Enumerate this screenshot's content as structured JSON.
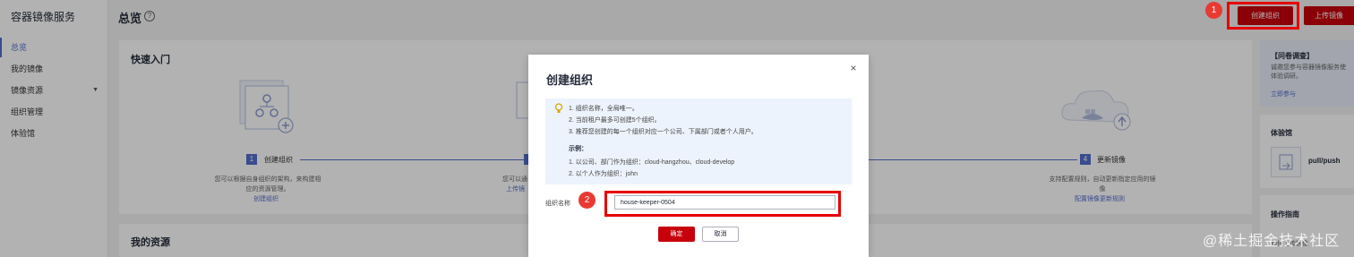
{
  "sidebar": {
    "title": "容器镜像服务",
    "items": [
      {
        "label": "总览"
      },
      {
        "label": "我的镜像"
      },
      {
        "label": "镜像资源"
      },
      {
        "label": "组织管理"
      },
      {
        "label": "体验馆"
      }
    ]
  },
  "header": {
    "title": "总览",
    "help_icon": "?",
    "create_org_label": "创建组织",
    "upload_label": "上传镜像",
    "badge1": "1"
  },
  "quick_start": {
    "title": "快速入门",
    "step1": {
      "num": "1",
      "label": "创建组织",
      "desc": "您可以根据自身组织的架构，来构建相应的资源管理。",
      "link": "创建组织"
    },
    "step2": {
      "desc_partial": "您可以通",
      "link_partial": "上传镜"
    },
    "step4": {
      "num": "4",
      "label": "更新镜像",
      "desc": "支持配置规则，自动更新指定应用的镜像",
      "link": "配置镜像更新规则"
    }
  },
  "resources": {
    "title": "我的资源"
  },
  "right_panel": {
    "survey": {
      "title": "【问卷调查】",
      "text1": "诚邀您参与容器镜像服务使",
      "text2": "体验调研。",
      "link": "立即参与"
    },
    "experience": {
      "title": "体验馆",
      "item": "pull/push"
    },
    "guide": {
      "title": "操作指南",
      "item1": "如何上传镜像"
    }
  },
  "modal": {
    "title": "创建组织",
    "close": "×",
    "tips": [
      "1. 组织名称，全局唯一。",
      "2. 当前租户最多可创建5个组织。",
      "3. 推荐您创建的每一个组织对应一个公司、下属部门或者个人用户。"
    ],
    "example_title": "示例：",
    "examples": [
      "1. 以公司、部门作为组织：cloud-hangzhou、cloud-develop",
      "2. 以个人作为组织：john"
    ],
    "field_label": "组织名称",
    "field_value": "house-keeper-0504",
    "badge2": "2",
    "ok_label": "确定",
    "cancel_label": "取消"
  },
  "watermark": "@稀土掘金技术社区",
  "colors": {
    "accent": "#c7000b",
    "link": "#526ecc",
    "highlight": "#e60000"
  }
}
